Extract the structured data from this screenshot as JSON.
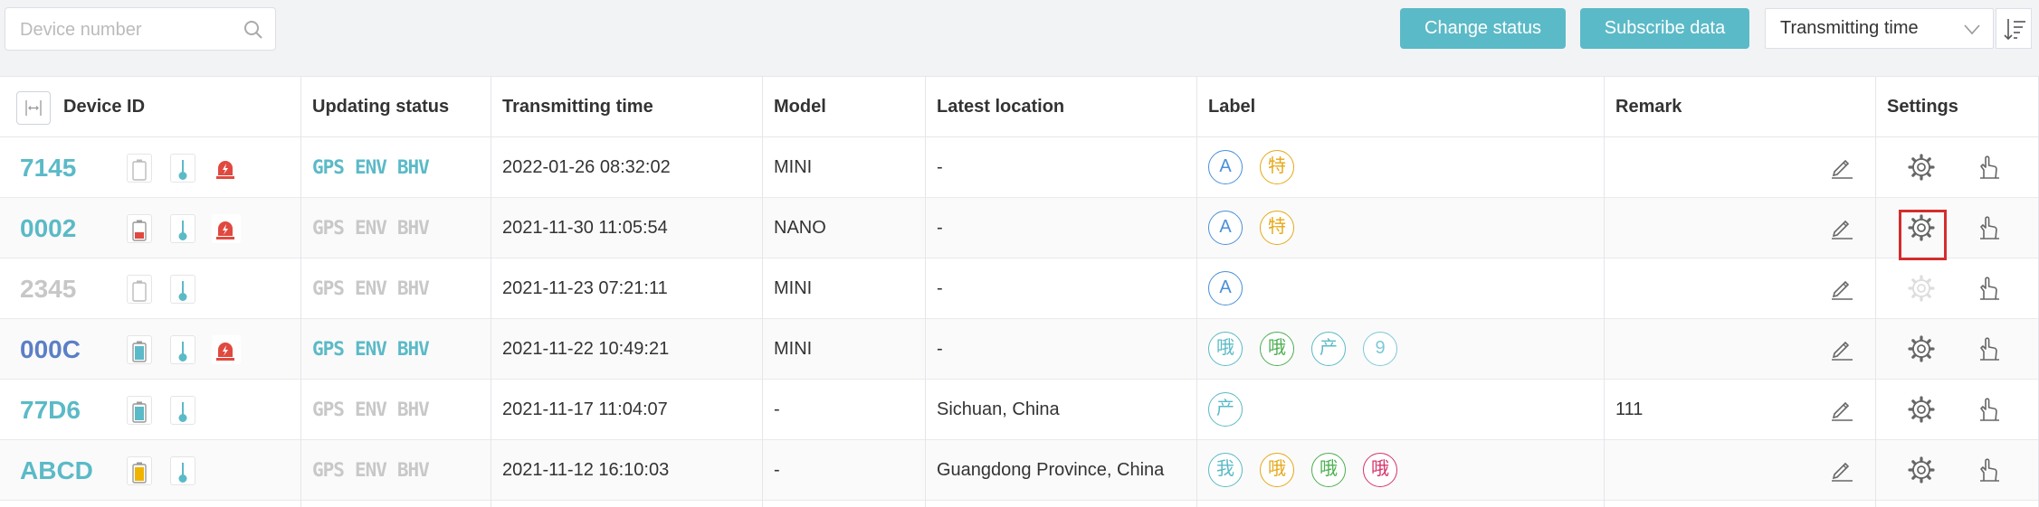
{
  "toolbar": {
    "search_placeholder": "Device number",
    "change_status_label": "Change status",
    "subscribe_data_label": "Subscribe data",
    "sort_select_value": "Transmitting time"
  },
  "table": {
    "headers": {
      "device_id": "Device ID",
      "updating_status": "Updating status",
      "transmitting_time": "Transmitting time",
      "model": "Model",
      "latest_location": "Latest location",
      "label": "Label",
      "remark": "Remark",
      "settings": "Settings"
    },
    "update_labels": [
      "GPS",
      "ENV",
      "BHV"
    ],
    "rows": [
      {
        "id": "7145",
        "id_color": "#5bbac7",
        "battery": "empty",
        "alarm": true,
        "updates": "active",
        "time": "2022-01-26 08:32:02",
        "model": "MINI",
        "location": "-",
        "remark": "",
        "settings_disabled": false,
        "tags": [
          {
            "text": "A",
            "color": "#4a90d9"
          },
          {
            "text": "特",
            "color": "#e6a817"
          }
        ]
      },
      {
        "id": "0002",
        "id_color": "#5bbac7",
        "battery": "low-red",
        "alarm": true,
        "updates": "inactive",
        "time": "2021-11-30 11:05:54",
        "model": "NANO",
        "location": "-",
        "remark": "",
        "settings_disabled": false,
        "tags": [
          {
            "text": "A",
            "color": "#4a90d9"
          },
          {
            "text": "特",
            "color": "#e6a817"
          }
        ]
      },
      {
        "id": "2345",
        "id_color": "#c7c7c7",
        "battery": "empty",
        "alarm": false,
        "updates": "inactive",
        "time": "2021-11-23 07:21:11",
        "model": "MINI",
        "location": "-",
        "remark": "",
        "settings_disabled": true,
        "tags": [
          {
            "text": "A",
            "color": "#4a90d9"
          }
        ]
      },
      {
        "id": "000C",
        "id_color": "#5b7fc7",
        "battery": "full-teal",
        "alarm": true,
        "updates": "active",
        "time": "2021-11-22 10:49:21",
        "model": "MINI",
        "location": "-",
        "remark": "",
        "settings_disabled": false,
        "tags": [
          {
            "text": "哦",
            "color": "#5bbac7"
          },
          {
            "text": "哦",
            "color": "#4caf50"
          },
          {
            "text": "产",
            "color": "#5bbac7"
          },
          {
            "text": "9",
            "color": "#7ec8d8"
          }
        ]
      },
      {
        "id": "77D6",
        "id_color": "#5bbac7",
        "battery": "full-teal",
        "alarm": false,
        "updates": "inactive",
        "time": "2021-11-17 11:04:07",
        "model": "-",
        "location": "Sichuan, China",
        "remark": "111",
        "settings_disabled": false,
        "tags": [
          {
            "text": "产",
            "color": "#5bbac7"
          }
        ]
      },
      {
        "id": "ABCD",
        "id_color": "#5bbac7",
        "battery": "full-yellow",
        "alarm": false,
        "updates": "inactive",
        "time": "2021-11-12 16:10:03",
        "model": "-",
        "location": "Guangdong Province, China",
        "remark": "",
        "settings_disabled": false,
        "tags": [
          {
            "text": "我",
            "color": "#5bbac7"
          },
          {
            "text": "哦",
            "color": "#e6a817"
          },
          {
            "text": "哦",
            "color": "#4caf50"
          },
          {
            "text": "哦",
            "color": "#d6336c"
          }
        ]
      }
    ]
  },
  "colors": {
    "accent": "#5bbac7",
    "update_active": "#5bbac7",
    "update_inactive": "#c8c8c8",
    "alarm_red": "#e0493f",
    "focus_border": "#d42d2d"
  },
  "icons": {
    "search": "search-icon",
    "sort": "sort-descending-icon",
    "chevron": "chevron-down-icon",
    "battery": "battery-icon",
    "thermometer": "thermometer-icon",
    "alarm": "alarm-light-icon",
    "edit": "pencil-icon",
    "settings": "gear-icon",
    "hand": "pointer-hand-icon",
    "column_drag": "column-resize-icon"
  }
}
